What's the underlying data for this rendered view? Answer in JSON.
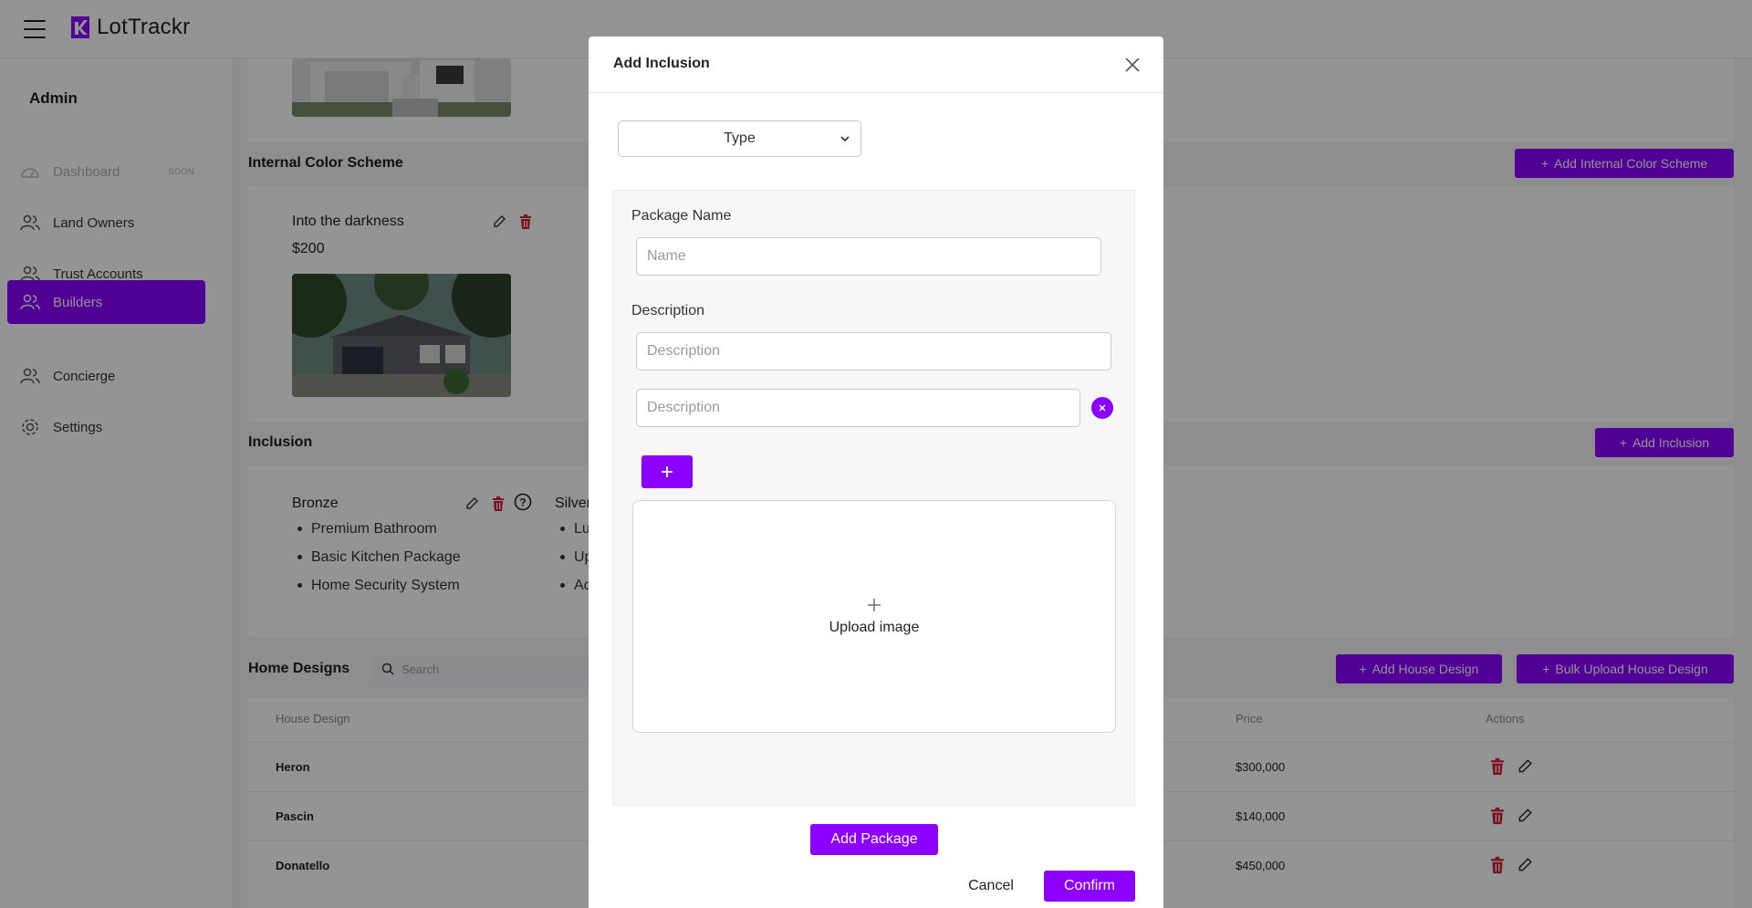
{
  "app": {
    "name": "LotTrackr"
  },
  "sidebar": {
    "section": "Admin",
    "items": [
      {
        "label": "Dashboard",
        "badge": "SOON",
        "icon": "dashboard-icon"
      },
      {
        "label": "Land Owners",
        "icon": "users-icon"
      },
      {
        "label": "Trust Accounts",
        "icon": "users-icon"
      },
      {
        "label": "Builders",
        "icon": "users-icon"
      },
      {
        "label": "Concierge",
        "icon": "users-icon"
      },
      {
        "label": "Settings",
        "icon": "gear-icon"
      }
    ]
  },
  "internal_color_scheme": {
    "title": "Internal Color Scheme",
    "add_label": "Add Internal Color Scheme",
    "item": {
      "name": "Into the darkness",
      "price": "$200"
    }
  },
  "inclusion": {
    "title": "Inclusion",
    "add_label": "Add Inclusion",
    "packages": [
      {
        "name": "Bronze",
        "items": [
          "Premium Bathroom",
          "Basic Kitchen Package",
          "Home Security System"
        ]
      },
      {
        "name": "Silver",
        "items": [
          "Lu",
          "Up",
          "Ac"
        ]
      }
    ]
  },
  "home_designs": {
    "title": "Home Designs",
    "search_placeholder": "Search",
    "add_label": "Add House Design",
    "bulk_label": "Bulk Upload House Design",
    "columns": {
      "design": "House Design",
      "price": "Price",
      "actions": "Actions"
    },
    "rows": [
      {
        "design": "Heron",
        "price": "$300,000"
      },
      {
        "design": "Pascin",
        "price": "$140,000"
      },
      {
        "design": "Donatello",
        "price": "$450,000"
      }
    ]
  },
  "modal": {
    "title": "Add Inclusion",
    "type_label": "Type",
    "package_name_label": "Package Name",
    "package_name_placeholder": "Name",
    "description_label": "Description",
    "description_placeholder": "Description",
    "upload_label": "Upload image",
    "add_package_label": "Add Package",
    "cancel_label": "Cancel",
    "confirm_label": "Confirm"
  },
  "colors": {
    "accent": "#8b00ff",
    "danger": "#d4203a"
  }
}
